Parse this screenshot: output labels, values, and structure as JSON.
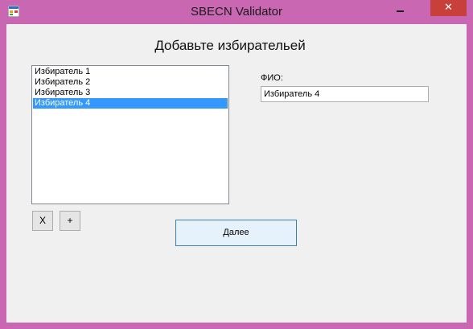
{
  "window": {
    "title": "SBECN Validator",
    "close_glyph": "✕",
    "icons": {
      "app": "app-window-icon",
      "minimize": "minimize-icon",
      "close": "close-icon"
    },
    "colors": {
      "frame": "#c967b3",
      "close_button": "#c7403a",
      "selection": "#3399ff"
    }
  },
  "main": {
    "heading": "Добавьте избирательей",
    "voters": {
      "items": [
        "Избиратель 1",
        "Избиратель 2",
        "Избиратель 3",
        "Избиратель 4"
      ],
      "selected_index": 3
    },
    "buttons": {
      "remove_label": "X",
      "add_label": "+",
      "next_label": "Далее"
    },
    "fio": {
      "label": "ФИО:",
      "value": "Избиратель 4"
    }
  }
}
